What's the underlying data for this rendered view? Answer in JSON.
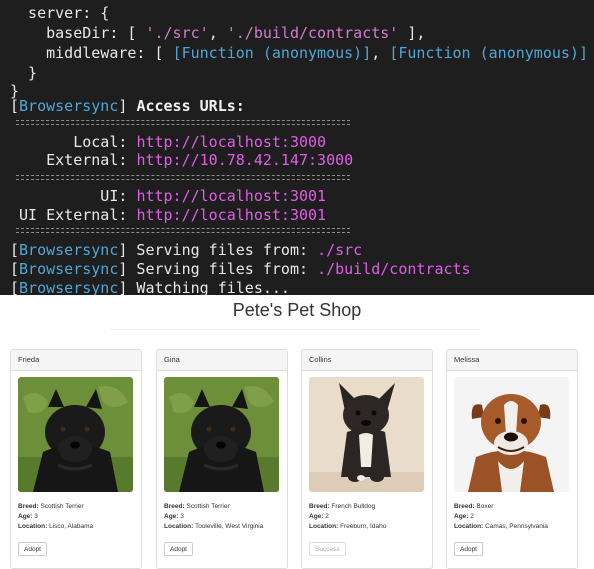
{
  "terminal": {
    "config_lines": {
      "server_open": "  server: {",
      "basedir_key": "    baseDir: [ ",
      "basedir_src": "'./src'",
      "basedir_sep": ", ",
      "basedir_contracts": "'./build/contracts'",
      "basedir_close": " ],",
      "middleware_key": "    middleware: [ ",
      "middleware_fn1": "[Function (anonymous)]",
      "middleware_sep": ", ",
      "middleware_fn2": "[Function (anonymous)]",
      "middleware_close": " ]",
      "inner_close": "  }",
      "outer_close": "}"
    },
    "tag": "Browsersync",
    "access_urls_heading": "Access URLs:",
    "local_label": "       Local: ",
    "local_url": "http://localhost:3000",
    "external_label": "    External: ",
    "external_url": "http://10.78.42.147:3000",
    "ui_label": "          UI: ",
    "ui_url": "http://localhost:3001",
    "ui_external_label": " UI External: ",
    "ui_external_url": "http://localhost:3001",
    "serving_1_text": " Serving files from: ",
    "serving_1_path": "./src",
    "serving_2_text": " Serving files from: ",
    "serving_2_path": "./build/contracts",
    "watching_text": " Watching files..."
  },
  "page": {
    "title": "Pete's Pet Shop",
    "breed_label": "Breed:",
    "age_label": "Age:",
    "location_label": "Location:",
    "pets": [
      {
        "name": "Frieda",
        "breed": "Scottish Terrier",
        "age": "3",
        "location": "Lisco, Alabama",
        "button": "Adopt",
        "image": "scottish-terrier"
      },
      {
        "name": "Gina",
        "breed": "Scottish Terrier",
        "age": "3",
        "location": "Tooleville, West Virginia",
        "button": "Adopt",
        "image": "scottish-terrier"
      },
      {
        "name": "Collins",
        "breed": "French Bulldog",
        "age": "2",
        "location": "Freeburn, Idaho",
        "button": "Success",
        "image": "french-bulldog"
      },
      {
        "name": "Melissa",
        "breed": "Boxer",
        "age": "2",
        "location": "Camas, Pennsylvania",
        "button": "Adopt",
        "image": "boxer"
      }
    ]
  },
  "colors": {
    "terminal_bg": "#1e1e1e",
    "string_magenta": "#d37bd0",
    "function_blue": "#4ea7d9",
    "url_magenta": "#e25ce8"
  }
}
